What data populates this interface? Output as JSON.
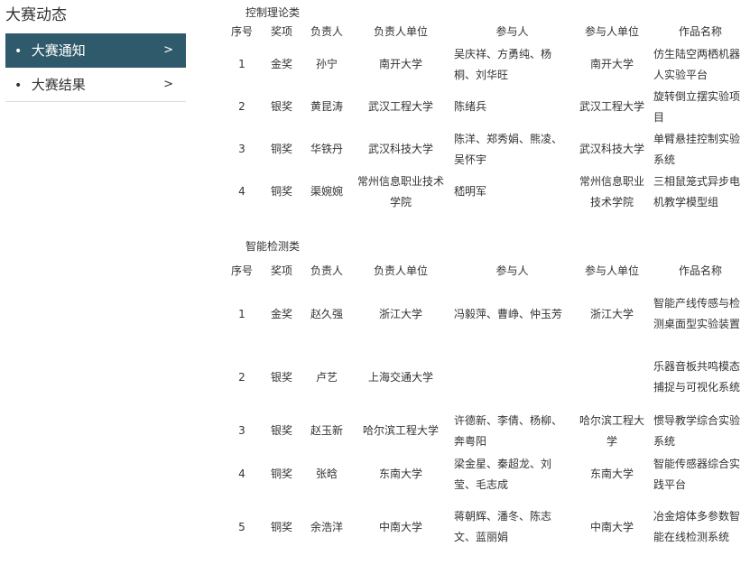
{
  "sidebar": {
    "title": "大赛动态",
    "items": [
      {
        "label": "大赛通知",
        "active": true
      },
      {
        "label": "大赛结果",
        "active": false
      }
    ]
  },
  "colors": {
    "active_bg": "#2f5a6b",
    "text": "#333333",
    "divider": "#dddddd"
  },
  "icons": {
    "bullet": "bullet-icon",
    "chevron": "chevron-right-icon"
  },
  "headers": [
    "序号",
    "奖项",
    "负责人",
    "负责人单位",
    "参与人",
    "参与人单位",
    "作品名称"
  ],
  "sections": [
    {
      "title": "控制理论类",
      "rows": [
        {
          "no": "1",
          "award": "金奖",
          "leader": "孙宁",
          "leader_unit": "南开大学",
          "members": "吴庆祥、方勇纯、杨桐、刘华旺",
          "member_unit": "南开大学",
          "work": "仿生陆空两栖机器人实验平台"
        },
        {
          "no": "2",
          "award": "银奖",
          "leader": "黄昆涛",
          "leader_unit": "武汉工程大学",
          "members": "陈绪兵",
          "member_unit": "武汉工程大学",
          "work": "旋转倒立摆实验项目"
        },
        {
          "no": "3",
          "award": "铜奖",
          "leader": "华铁丹",
          "leader_unit": "武汉科技大学",
          "members": "陈洋、郑秀娟、熊凌、吴怀宇",
          "member_unit": "武汉科技大学",
          "work": "单臂悬挂控制实验系统"
        },
        {
          "no": "4",
          "award": "铜奖",
          "leader": "渠婉婉",
          "leader_unit": "常州信息职业技术学院",
          "members": "嵇明军",
          "member_unit": "常州信息职业技术学院",
          "work": "三相鼠笼式异步电机教学模型组"
        }
      ]
    },
    {
      "title": "智能检测类",
      "rows": [
        {
          "no": "1",
          "award": "金奖",
          "leader": "赵久强",
          "leader_unit": "浙江大学",
          "members": "冯毅萍、曹峥、仲玉芳",
          "member_unit": "浙江大学",
          "work": "智能产线传感与检测桌面型实验装置"
        },
        {
          "no": "2",
          "award": "银奖",
          "leader": "卢艺",
          "leader_unit": "上海交通大学",
          "members": "",
          "member_unit": "",
          "work": "乐器音板共鸣模态捕捉与可视化系统"
        },
        {
          "no": "3",
          "award": "银奖",
          "leader": "赵玉新",
          "leader_unit": "哈尔滨工程大学",
          "members": "许德新、李倩、杨柳、奔粤阳",
          "member_unit": "哈尔滨工程大学",
          "work": "惯导教学综合实验系统"
        },
        {
          "no": "4",
          "award": "铜奖",
          "leader": "张晗",
          "leader_unit": "东南大学",
          "members": "梁金星、秦超龙、刘莹、毛志成",
          "member_unit": "东南大学",
          "work": "智能传感器综合实践平台"
        },
        {
          "no": "5",
          "award": "铜奖",
          "leader": "余浩洋",
          "leader_unit": "中南大学",
          "members": "蒋朝辉、潘冬、陈志文、蓝丽娟",
          "member_unit": "中南大学",
          "work": "冶金熔体多参数智能在线检测系统"
        }
      ]
    }
  ]
}
